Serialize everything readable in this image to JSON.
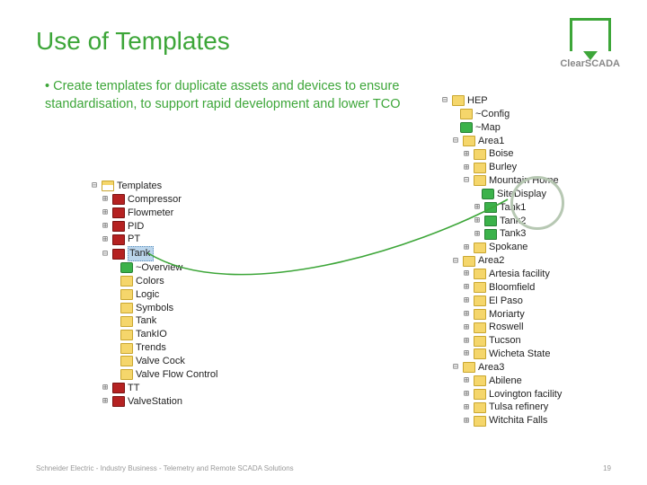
{
  "title": "Use of Templates",
  "bullet": "Create templates for duplicate assets and devices to ensure standardisation, to support rapid development and lower TCO",
  "logo_text": "ClearSCADA",
  "left": {
    "root": "Templates",
    "n0": "Compressor",
    "n1": "Flowmeter",
    "n2": "PID",
    "n3": "PT",
    "n4": "Tank",
    "c0": "~Overview",
    "c1": "Colors",
    "c2": "Logic",
    "c3": "Symbols",
    "c4": "Tank",
    "c5": "TankIO",
    "c6": "Trends",
    "c7": "Valve Cock",
    "c8": "Valve Flow Control",
    "n5": "TT",
    "n6": "ValveStation"
  },
  "right": {
    "root": "HEP",
    "cfg": "~Config",
    "map": "~Map",
    "a1": "Area1",
    "a1_0": "Boise",
    "a1_1": "Burley",
    "a1_2": "Mountain Home",
    "mh_0": "SiteDisplay",
    "mh_1": "Tank1",
    "mh_2": "Tank2",
    "mh_3": "Tank3",
    "a1_3": "Spokane",
    "a2": "Area2",
    "a2_0": "Artesia facility",
    "a2_1": "Bloomfield",
    "a2_2": "El Paso",
    "a2_3": "Moriarty",
    "a2_4": "Roswell",
    "a2_5": "Tucson",
    "a2_6": "Wicheta State",
    "a3": "Area3",
    "a3_0": "Abilene",
    "a3_1": "Lovington facility",
    "a3_2": "Tulsa refinery",
    "a3_3": "Witchita Falls"
  },
  "footer_left": "Schneider Electric - Industry Business - Telemetry and Remote SCADA Solutions",
  "footer_right": "19"
}
